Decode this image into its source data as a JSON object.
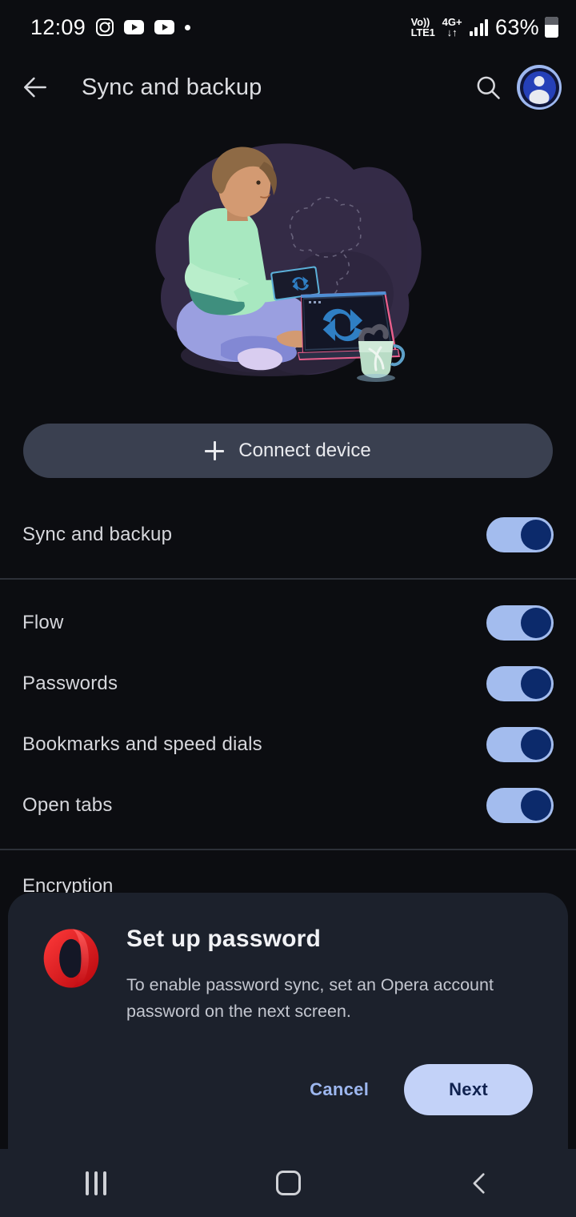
{
  "status_bar": {
    "time": "12:09",
    "notification_icons": [
      "instagram-icon",
      "youtube-icon",
      "youtube-icon",
      "dot-icon"
    ],
    "volte_line1": "Vo))",
    "volte_line2": "LTE1",
    "network_type": "4G+",
    "data_arrows": "↓↑",
    "signal_bars": 4,
    "battery_percent": "63%",
    "battery_level": 63
  },
  "app_bar": {
    "back_icon": "arrow-left-icon",
    "title": "Sync and backup",
    "search_icon": "search-icon",
    "avatar_icon": "account-avatar-icon"
  },
  "illustration": {
    "name": "sync-devices-illustration",
    "alt": "Person sitting cross-legged holding a tablet in front of a laptop, both showing sync arrows"
  },
  "connect_device": {
    "icon": "plus-icon",
    "label": "Connect device"
  },
  "settings": {
    "primary": [
      {
        "label": "Sync and backup",
        "toggle": true
      }
    ],
    "items": [
      {
        "label": "Flow",
        "toggle": true
      },
      {
        "label": "Passwords",
        "toggle": true
      },
      {
        "label": "Bookmarks and speed dials",
        "toggle": true
      },
      {
        "label": "Open tabs",
        "toggle": true
      }
    ],
    "encryption_label": "Encryption"
  },
  "dialog": {
    "logo_icon": "opera-logo-icon",
    "title": "Set up password",
    "body": "To enable password sync, set an Opera account password on the next screen.",
    "cancel_label": "Cancel",
    "next_label": "Next"
  },
  "nav_bar": {
    "recents_icon": "recents-icon",
    "home_icon": "home-icon",
    "back_icon": "nav-back-icon"
  },
  "colors": {
    "background": "#0c0d11",
    "dialog_background": "#1c212c",
    "toggle_track": "#a3bcee",
    "toggle_knob": "#0c2a6b",
    "accent": "#9db7ef",
    "next_button": "#c3d2f8",
    "connect_button": "#3a4050",
    "opera_red": "#e3242b"
  }
}
